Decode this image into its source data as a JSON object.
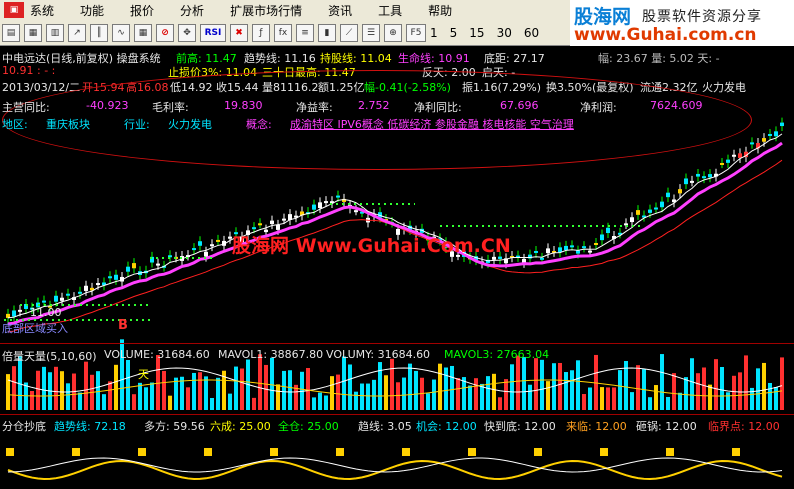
{
  "menu": {
    "items": [
      "系统",
      "功能",
      "报价",
      "分析",
      "扩展市场行情",
      "资讯",
      "工具",
      "帮助"
    ]
  },
  "toolbar": {
    "rsi": "RSI",
    "f5": "F5",
    "periods": [
      "1",
      "5",
      "15",
      "30",
      "60"
    ]
  },
  "brand": {
    "name": "股海网",
    "slogan": "股票软件资源分享",
    "url": "www.Guhai.com.cn"
  },
  "header": {
    "title": "中电远达(日线,前复权) 操盘系统",
    "prev_high": "前高: 11.47",
    "trend_line": "趋势线: 11.16",
    "hold_line": "持股线: 11.04",
    "life_line": "生命线: 10.91",
    "bottom_dist": "底距: 27.17",
    "row2_left": "10.91 : - :",
    "stop_loss": "止损价3%: 11.04",
    "thirty_high": "三十日最高: 11.47",
    "fan_tian": "反天: 2.00",
    "qi_tian": "启天: -",
    "right_clip": "幅: 23.67  量: 5.02  天: -"
  },
  "quote": {
    "date": "2013/03/12/二",
    "open": "开15.94",
    "high": "高16.08",
    "low": "低14.92",
    "close": "收15.44",
    "vol": "量81116.2",
    "amt": "额1.25亿",
    "chg_amt": "幅-0.41(-2.58%)",
    "amp": "振1.16(7.29%)",
    "turnover": "换3.50%(最复权)",
    "float": "流通2.32亿",
    "sector": "火力发电"
  },
  "fundamental": {
    "rev_growth_label": "主营同比:",
    "rev_growth_val": "-40.923",
    "gross_label": "毛利率:",
    "gross_val": "19.830",
    "roe_label": "净益率:",
    "roe_val": "2.752",
    "profit_growth_label": "净利同比:",
    "profit_growth_val": "67.696",
    "net_profit_label": "净利润:",
    "net_profit_val": "7624.609",
    "region_label": "地区:",
    "region_val": "重庆板块",
    "industry_label": "行业:",
    "industry_val": "火力发电",
    "concept_label": "概念:",
    "concept_val": "成渝特区 IPV6概念 低碳经济 参股金融 核电核能 空气治理"
  },
  "main_chart": {
    "price_label": "11.00",
    "signal_label": "B",
    "bottom_text": "底部区域买入",
    "watermark": "股海网 Www.Guhai.Com.CN"
  },
  "volume_panel": {
    "title": "倍量天量(5,10,60)",
    "volume": "VOLUME: 31684.60",
    "mavol1": "MAVOL1: 38867.80",
    "volumy": "VOLUMY: 31684.60",
    "mavol3": "MAVOL3: 27663.04",
    "tian_label": "天"
  },
  "indicator_panel": {
    "title": "分仓抄底",
    "trend": "趋势线: 72.18",
    "bull": "多方: 59.56",
    "six": "六成: 25.00",
    "full": "全仓: 25.00",
    "trend2": "趋线: 3.05",
    "chance": "机会: 12.00",
    "near_bottom": "快到底: 12.00",
    "coming": "来临: 12.00",
    "breakthrough": "砸锅: 12.00",
    "critical": "临界点: 12.00"
  },
  "colors": {
    "up": "#ff3030",
    "down": "#00e5ff",
    "ma_life": "#ff40ff",
    "ma_trend": "#ffffff",
    "bg": "#000000"
  }
}
